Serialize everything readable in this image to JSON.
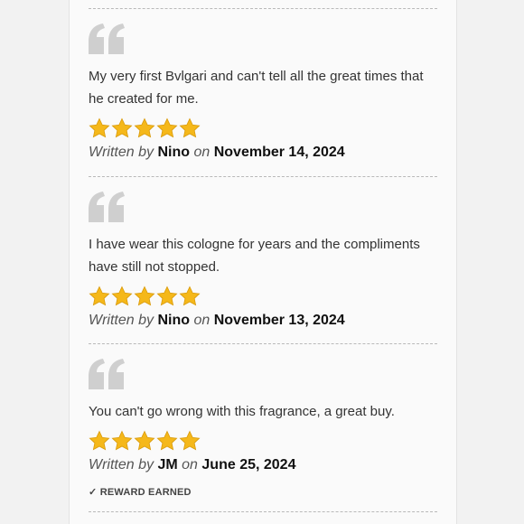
{
  "reviews": [
    {
      "text": "My very first Bvlgari and can't tell all the great times that he created for me.",
      "rating": 5,
      "written_by": "Written by",
      "author": "Nino",
      "on": "on",
      "date": "November 14, 2024"
    },
    {
      "text": "I have wear this cologne for years and the compliments have still not stopped.",
      "rating": 5,
      "written_by": "Written by",
      "author": "Nino",
      "on": "on",
      "date": "November 13, 2024"
    },
    {
      "text": "You can't go wrong with this fragrance, a great buy.",
      "rating": 5,
      "written_by": "Written by",
      "author": "JM",
      "on": "on",
      "date": "June 25, 2024"
    }
  ],
  "reward": {
    "check": "✓",
    "label": "REWARD EARNED"
  },
  "colors": {
    "star": "#f5b81a",
    "star_stroke": "#d99a0a",
    "quote": "#cfcfcf",
    "divider": "#b9b9b9"
  },
  "icons": {
    "quote": "quote-icon",
    "star": "star-icon",
    "check": "check-icon"
  }
}
